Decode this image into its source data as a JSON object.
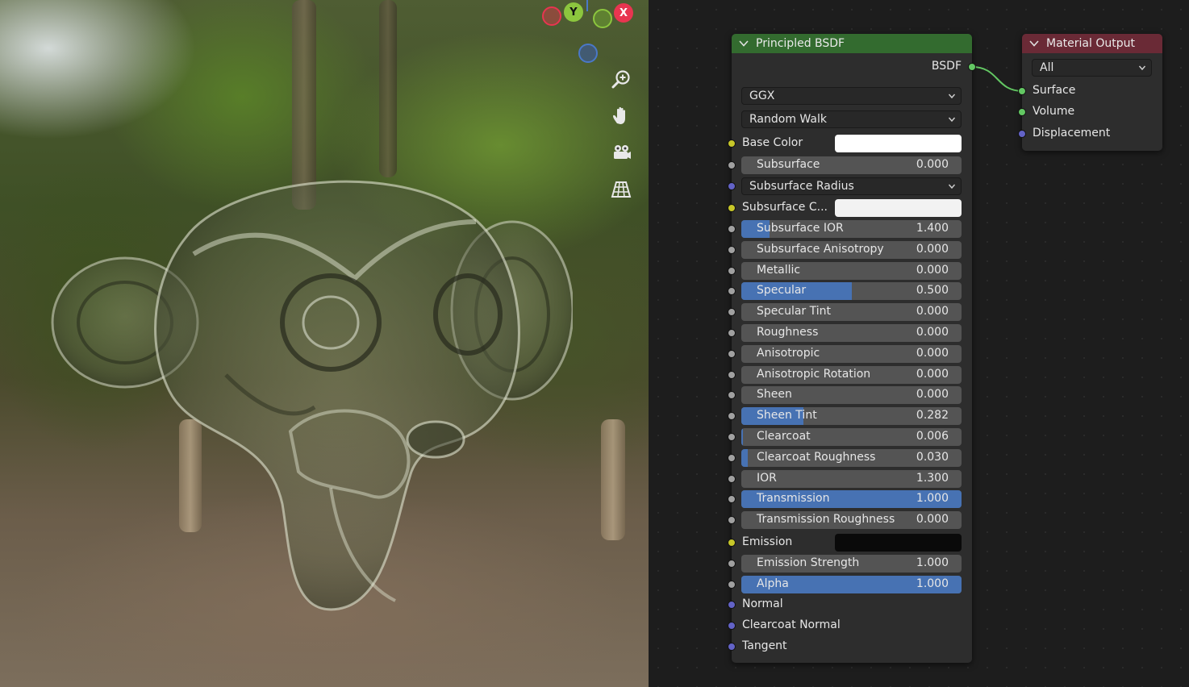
{
  "viewport": {
    "gizmo": {
      "y_label": "Y",
      "x_label": "X"
    },
    "tools": [
      {
        "icon": "zoom-icon"
      },
      {
        "icon": "pan-hand-icon"
      },
      {
        "icon": "camera-icon"
      },
      {
        "icon": "perspective-grid-icon"
      }
    ]
  },
  "principled": {
    "title": "Principled BSDF",
    "output_label": "BSDF",
    "distribution": "GGX",
    "subsurface_method": "Random Walk",
    "base_color_label": "Base Color",
    "base_color": "#ffffff",
    "subsurface": {
      "label": "Subsurface",
      "value": "0.000",
      "fill": 0.0
    },
    "subsurface_radius_label": "Subsurface Radius",
    "subsurface_color_label": "Subsurface C...",
    "subsurface_color": "#f2f2f2",
    "fields": [
      {
        "label": "Subsurface IOR",
        "value": "1.400",
        "fill": 0.13
      },
      {
        "label": "Subsurface Anisotropy",
        "value": "0.000",
        "fill": 0.0
      },
      {
        "label": "Metallic",
        "value": "0.000",
        "fill": 0.0
      },
      {
        "label": "Specular",
        "value": "0.500",
        "fill": 0.5
      },
      {
        "label": "Specular Tint",
        "value": "0.000",
        "fill": 0.0
      },
      {
        "label": "Roughness",
        "value": "0.000",
        "fill": 0.0
      },
      {
        "label": "Anisotropic",
        "value": "0.000",
        "fill": 0.0
      },
      {
        "label": "Anisotropic Rotation",
        "value": "0.000",
        "fill": 0.0
      },
      {
        "label": "Sheen",
        "value": "0.000",
        "fill": 0.0
      },
      {
        "label": "Sheen Tint",
        "value": "0.282",
        "fill": 0.282
      },
      {
        "label": "Clearcoat",
        "value": "0.006",
        "fill": 0.006
      },
      {
        "label": "Clearcoat Roughness",
        "value": "0.030",
        "fill": 0.03
      },
      {
        "label": "IOR",
        "value": "1.300",
        "fill": 0.0
      },
      {
        "label": "Transmission",
        "value": "1.000",
        "fill": 1.0
      },
      {
        "label": "Transmission Roughness",
        "value": "0.000",
        "fill": 0.0
      }
    ],
    "emission_label": "Emission",
    "emission_color": "#0a0a0a",
    "emission_strength": {
      "label": "Emission Strength",
      "value": "1.000",
      "fill": 0.0
    },
    "alpha": {
      "label": "Alpha",
      "value": "1.000",
      "fill": 1.0
    },
    "normal_label": "Normal",
    "clearcoat_normal_label": "Clearcoat Normal",
    "tangent_label": "Tangent"
  },
  "output": {
    "title": "Material Output",
    "target": "All",
    "inputs": [
      "Surface",
      "Volume",
      "Displacement"
    ]
  },
  "colors": {
    "principled_header": "#336b2f",
    "output_header": "#6a2a36",
    "slider_fill": "#4772b3",
    "socket_shader": "#63c763",
    "socket_color": "#c7c729",
    "socket_float": "#a1a1a1",
    "socket_vector": "#6363c7"
  }
}
